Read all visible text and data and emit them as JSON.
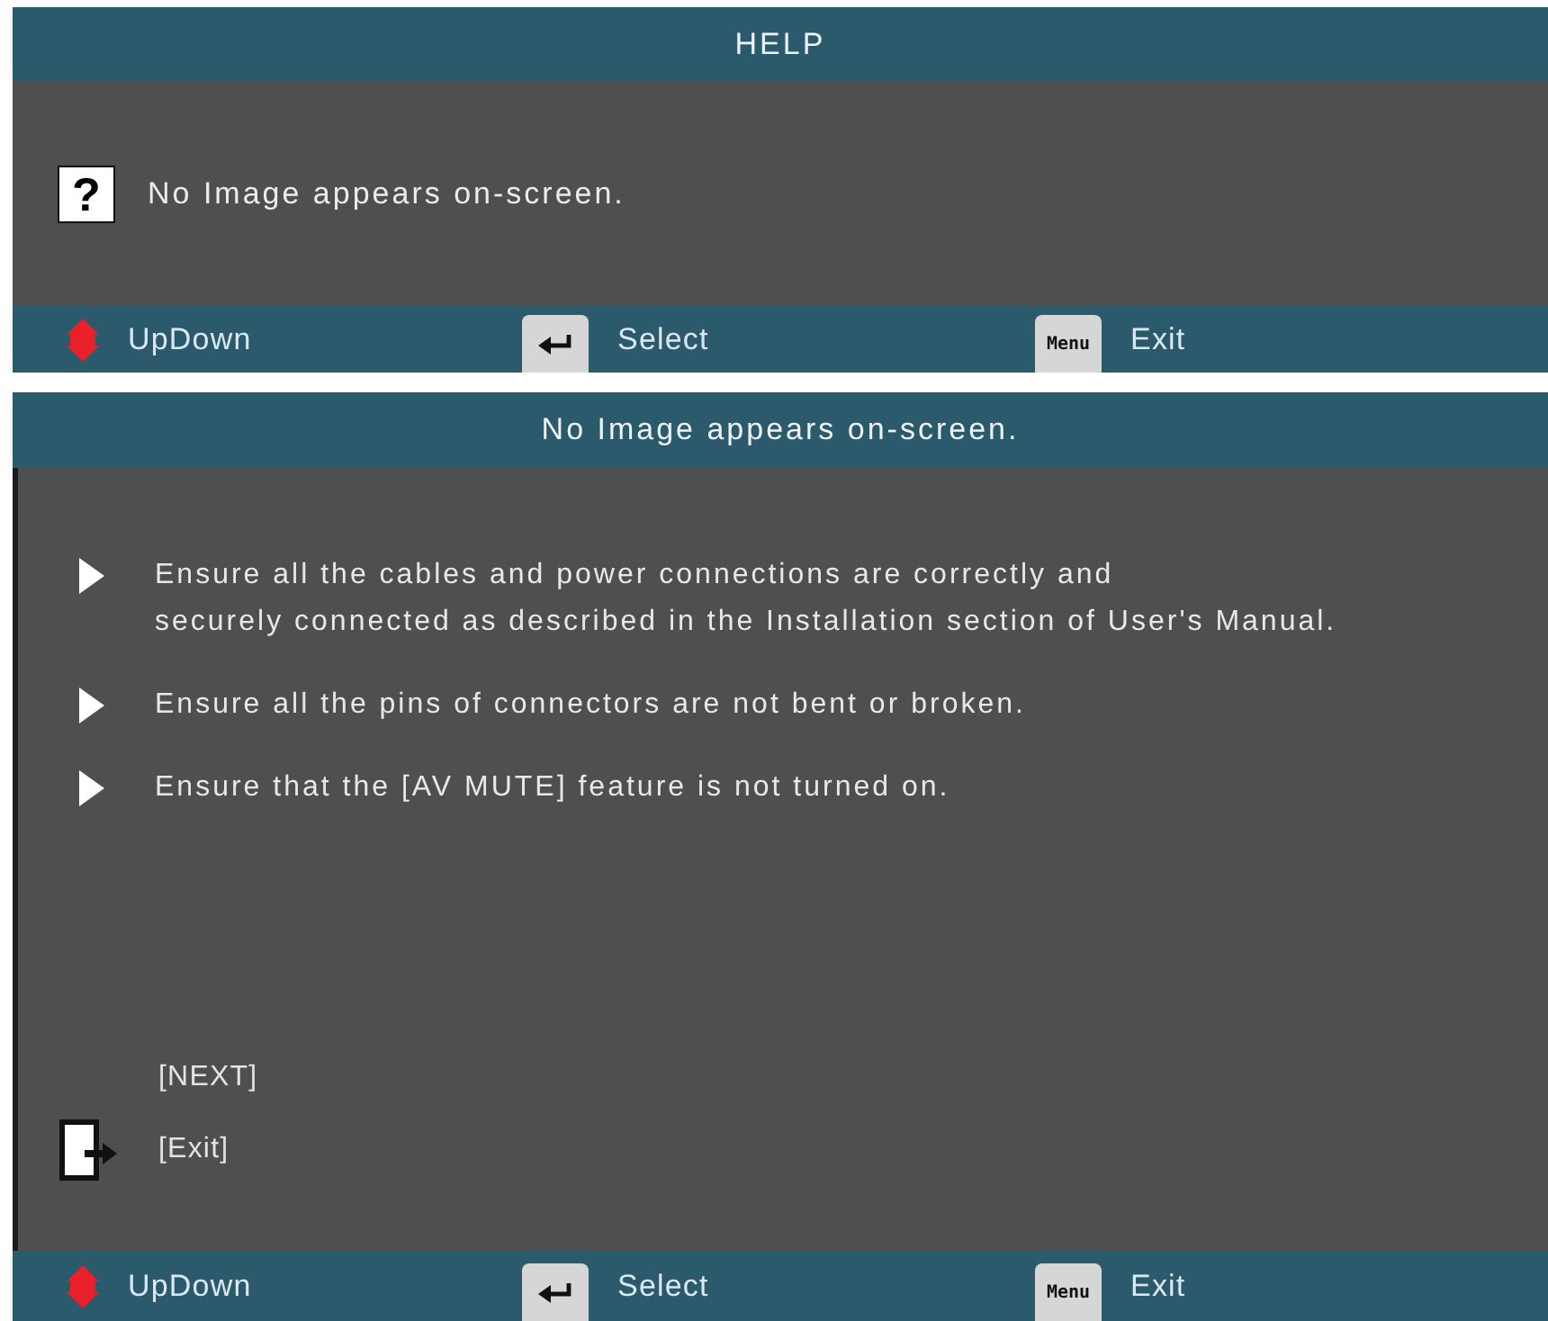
{
  "help_bar": {
    "title": "HELP",
    "help_icon": "?",
    "question": "No Image appears on-screen.",
    "footer": [
      {
        "kind": "updown",
        "label": "UpDown"
      },
      {
        "kind": "enter",
        "label": "Select"
      },
      {
        "kind": "menu",
        "key": "Menu",
        "label": "Exit"
      }
    ]
  },
  "detail": {
    "title": "No Image appears on-screen.",
    "tips": [
      {
        "lines": [
          "Ensure all the cables and power connections are correctly and",
          "securely connected as described in the Installation section of User's Manual."
        ]
      },
      {
        "lines": [
          "Ensure all the pins of connectors are not bent or broken."
        ]
      },
      {
        "lines": [
          "Ensure that the [AV MUTE] feature is not turned on."
        ]
      }
    ],
    "actions": [
      {
        "kind": "next",
        "label": "[NEXT]"
      },
      {
        "kind": "exit",
        "label": "[Exit]"
      }
    ],
    "footer": [
      {
        "kind": "updown",
        "label": "UpDown"
      },
      {
        "kind": "enter",
        "label": "Select"
      },
      {
        "kind": "menu",
        "key": "Menu",
        "label": "Exit"
      }
    ]
  }
}
